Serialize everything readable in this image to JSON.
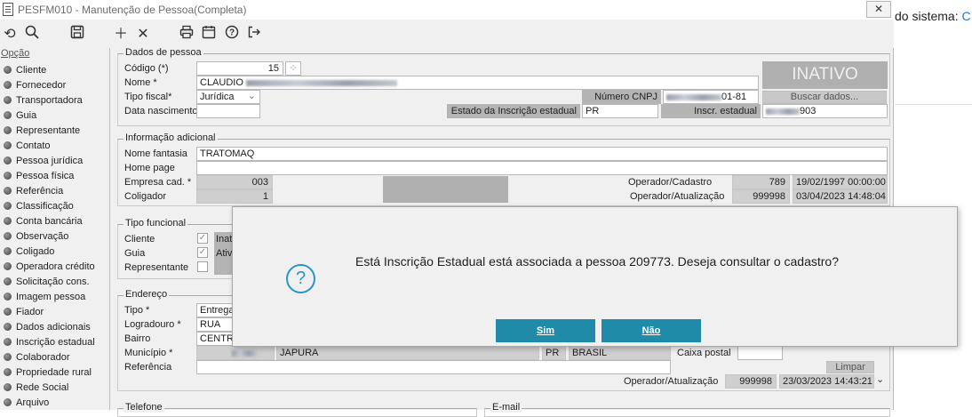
{
  "window": {
    "title": "PESFM010 - Manutenção de Pessoa(Completa)",
    "close_label": "✕"
  },
  "right_pane": {
    "text": "do sistema: ",
    "accent": "C"
  },
  "toolbar": [
    "undo-icon",
    "search-icon",
    "save-icon",
    "add-icon",
    "delete-icon",
    "print-icon",
    "calendar-icon",
    "help-icon",
    "exit-icon"
  ],
  "sidebar": {
    "header": "Opção",
    "items": [
      "Cliente",
      "Fornecedor",
      "Transportadora",
      "Guia",
      "Representante",
      "Contato",
      "Pessoa jurídica",
      "Pessoa física",
      "Referência",
      "Classificação",
      "Conta bancária",
      "Observação",
      "Coligado",
      "Operadora crédito",
      "Solicitação cons.",
      "Imagem pessoa",
      "Fiador",
      "Dados adicionais",
      "Inscrição estadual",
      "Colaborador",
      "Propriedade rural",
      "Rede Social",
      "Arquivo"
    ]
  },
  "dados": {
    "title": "Dados de pessoa",
    "codigo_label": "Código (*)",
    "codigo": "15",
    "nome_label": "Nome *",
    "nome": "CLAUDIO",
    "tipo_fiscal_label": "Tipo fiscal*",
    "tipo_fiscal": "Jurídica",
    "data_nasc_label": "Data nascimento",
    "cnpj_label": "Número CNPJ",
    "cnpj_suffix": "01-81",
    "buscar": "Buscar dados...",
    "estado_label": "Estado da Inscrição estadual",
    "estado": "PR",
    "inscr_label": "Inscr. estadual",
    "inscr_suffix": "903",
    "status": "INATIVO"
  },
  "info": {
    "title": "Informação adicional",
    "fantasia_label": "Nome fantasia",
    "fantasia": "TRATOMAQ",
    "homepage_label": "Home page",
    "empresa_label": "Empresa cad. *",
    "empresa": "003",
    "coligador_label": "Coligador",
    "coligador": "1",
    "op_cad_label": "Operador/Cadastro",
    "op_cad": "789",
    "op_cad_date": "19/02/1997 00:00:00",
    "op_at_label": "Operador/Atualização",
    "op_at": "999998",
    "op_at_date": "03/04/2023 14:48:04"
  },
  "tipo_funcional": {
    "title": "Tipo funcional",
    "rows": [
      {
        "label": "Cliente",
        "checked": "✓",
        "status": "Inat"
      },
      {
        "label": "Guia",
        "checked": "✓",
        "status": "Ativ"
      },
      {
        "label": "Representante",
        "checked": "",
        "status": ""
      }
    ]
  },
  "endereco": {
    "title": "Endereço",
    "tipo_label": "Tipo *",
    "tipo": "Entrega",
    "logradouro_label": "Logradouro *",
    "logradouro": "RUA",
    "bairro_label": "Bairro",
    "bairro": "CENTRO",
    "municipio_label": "Município *",
    "municipio": "JAPURA",
    "uf": "PR",
    "pais": "BRASIL",
    "caixa_label": "Caixa postal",
    "referencia_label": "Referência",
    "limpar": "Limpar",
    "op_at_label": "Operador/Atualização",
    "op_at": "999998",
    "op_at_date": "23/03/2023 14:43:21"
  },
  "bottom": {
    "telefone": "Telefone",
    "email": "E-mail"
  },
  "dialog": {
    "icon": "?",
    "message": "Está Inscrição Estadual está associada a pessoa 209773. Deseja consultar o cadastro?",
    "yes": "Sim",
    "no": "Não"
  }
}
